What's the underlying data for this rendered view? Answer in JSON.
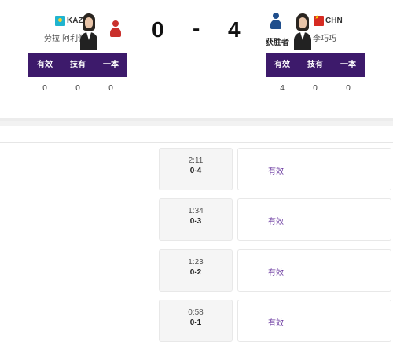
{
  "left_athlete": {
    "country": "KAZ",
    "name": "劳拉 阿利佩尔",
    "flag_icon": "kaz-flag-icon",
    "stats": [
      "0",
      "0",
      "0"
    ]
  },
  "right_athlete": {
    "country": "CHN",
    "name": "李巧巧",
    "flag_icon": "chn-flag-icon",
    "winner_label": "获胜者",
    "stats": [
      "4",
      "0",
      "0"
    ]
  },
  "score": {
    "left": "0",
    "sep": "-",
    "right": "4"
  },
  "stat_headers": [
    "有效",
    "技有",
    "一本"
  ],
  "colors": {
    "header_purple": "#3d1a6b",
    "action_purple": "#6b3aa0",
    "left_user": "#c9302c",
    "right_user": "#1f4e8c"
  },
  "events": [
    {
      "time": "2:11",
      "score": "0-4",
      "action": "有效"
    },
    {
      "time": "1:34",
      "score": "0-3",
      "action": "有效"
    },
    {
      "time": "1:23",
      "score": "0-2",
      "action": "有效"
    },
    {
      "time": "0:58",
      "score": "0-1",
      "action": "有效"
    }
  ]
}
